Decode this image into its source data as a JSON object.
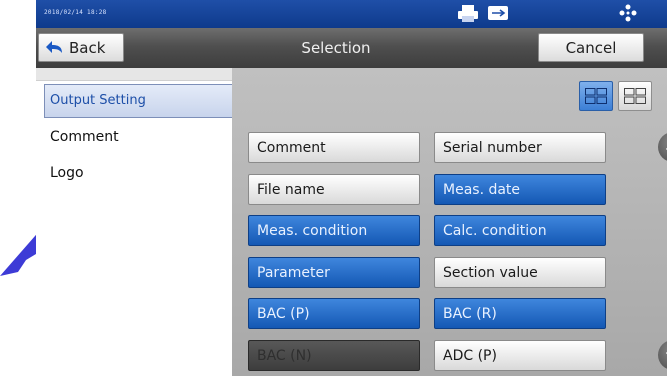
{
  "status_bar": {
    "datetime": "2018/02/14 18:28"
  },
  "header": {
    "back_label": "Back",
    "title": "Selection",
    "cancel_label": "Cancel"
  },
  "sidebar": {
    "items": [
      {
        "label": "Output Setting",
        "active": true
      },
      {
        "label": "Comment",
        "active": false
      },
      {
        "label": "Logo",
        "active": false
      }
    ]
  },
  "items": [
    {
      "label": "Comment",
      "state": "off"
    },
    {
      "label": "Serial number",
      "state": "off"
    },
    {
      "label": "File name",
      "state": "off"
    },
    {
      "label": "Meas. date",
      "state": "on"
    },
    {
      "label": "Meas. condition",
      "state": "on"
    },
    {
      "label": "Calc. condition",
      "state": "on"
    },
    {
      "label": "Parameter",
      "state": "on"
    },
    {
      "label": "Section value",
      "state": "off"
    },
    {
      "label": "BAC (P)",
      "state": "on"
    },
    {
      "label": "BAC (R)",
      "state": "on"
    },
    {
      "label": "BAC (N)",
      "state": "disabled"
    },
    {
      "label": "ADC (P)",
      "state": "off"
    }
  ],
  "colors": {
    "selected": "#1e63c0",
    "status_bar": "#1f4fa8",
    "title_bar": "#4f4f4f",
    "pointer_arrow": "#3d3bd6"
  }
}
